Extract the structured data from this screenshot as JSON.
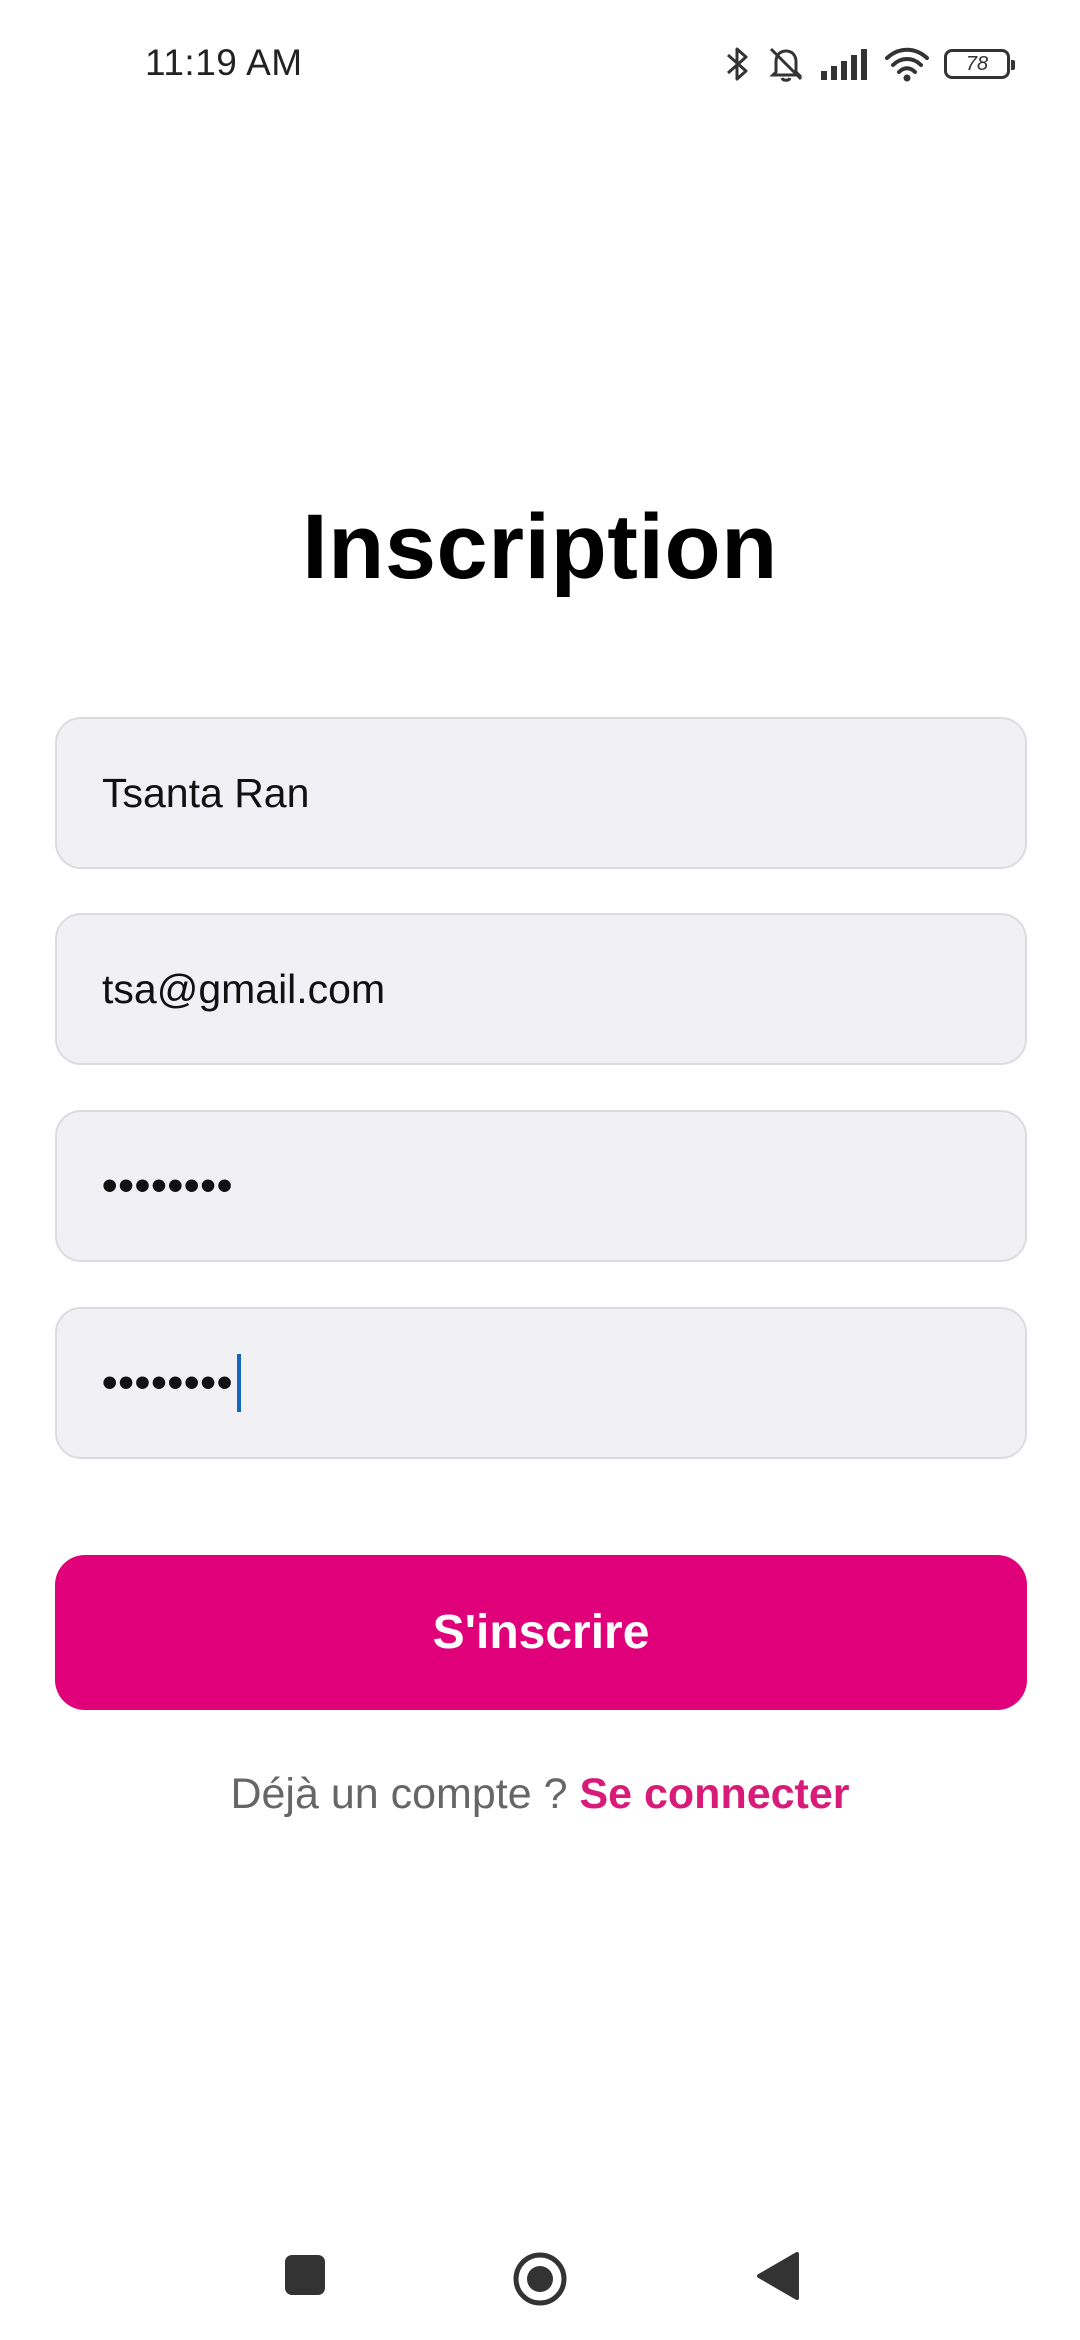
{
  "status_bar": {
    "time": "11:19 AM",
    "battery_level": "78",
    "icons": [
      "bluetooth-icon",
      "bell-muted-icon",
      "signal-icon",
      "wifi-icon",
      "battery-icon"
    ]
  },
  "page": {
    "title": "Inscription"
  },
  "form": {
    "name_value": "Tsanta Ran",
    "email_value": "tsa@gmail.com",
    "password_masked": "••••••••",
    "confirm_password_masked": "••••••••",
    "submit_label": "S'inscrire"
  },
  "footer": {
    "prompt": "Déjà un compte ? ",
    "login_link": "Se connecter"
  },
  "colors": {
    "accent": "#e0007a",
    "link": "#d81b78",
    "field_bg": "#f1f1f5"
  },
  "nav": {
    "icons": [
      "recents-square-icon",
      "home-circle-icon",
      "back-triangle-icon"
    ]
  }
}
